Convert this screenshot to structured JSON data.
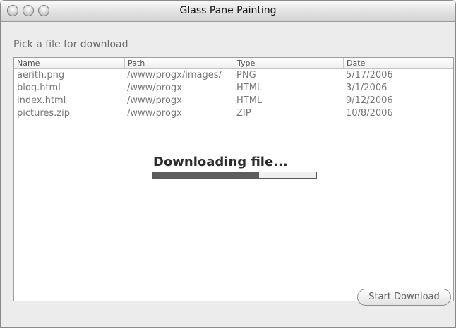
{
  "window": {
    "title": "Glass Pane Painting"
  },
  "prompt": "Pick a file for download",
  "table": {
    "columns": [
      "Name",
      "Path",
      "Type",
      "Date"
    ],
    "rows": [
      [
        "aerith.png",
        "/www/progx/images/",
        "PNG",
        "5/17/2006"
      ],
      [
        "blog.html",
        "/www/progx",
        "HTML",
        "3/1/2006"
      ],
      [
        "index.html",
        "/www/progx",
        "HTML",
        "9/12/2006"
      ],
      [
        "pictures.zip",
        "/www/progx",
        "ZIP",
        "10/8/2006"
      ]
    ]
  },
  "overlay": {
    "message": "Downloading file...",
    "progress": 0.65
  },
  "buttons": {
    "start_download": "Start Download"
  },
  "colors": {
    "progress_fill": "#5e5e5e",
    "window_bg": "#ececec"
  },
  "icons": [
    "close-window-icon",
    "minimize-window-icon",
    "zoom-window-icon"
  ]
}
